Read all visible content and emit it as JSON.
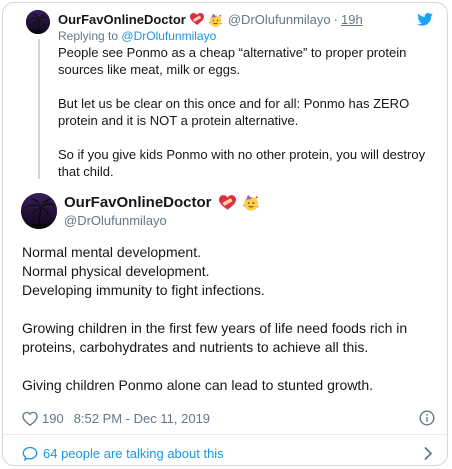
{
  "parent_tweet": {
    "display_name": "OurFavOnlineDoctor",
    "name_emojis": [
      "heart-bandage-icon",
      "party-face-icon"
    ],
    "handle": "@DrOlufunmilayo",
    "separator": "·",
    "time": "19h",
    "replying_prefix": "Replying to",
    "replying_handle": "@DrOlufunmilayo",
    "paragraphs": [
      "People see Ponmo as a cheap “alternative” to proper protein sources like meat, milk or eggs.",
      "But let us be clear on this once and for all: Ponmo has ZERO protein and it is NOT a protein alternative.",
      "So if you give kids Ponmo with no other protein, you will destroy that child."
    ]
  },
  "main_tweet": {
    "display_name": "OurFavOnlineDoctor",
    "handle": "@DrOlufunmilayo",
    "paragraphs": [
      "Normal mental development.\nNormal physical development.\nDeveloping immunity to fight infections.",
      "Growing children in the first few years of life need foods rich in proteins, carbohydrates and nutrients to achieve all this.",
      "Giving children Ponmo alone can lead to stunted growth."
    ],
    "likes": "190",
    "timestamp": "8:52 PM - Dec 11, 2019"
  },
  "footer": {
    "conversation_text": "64 people are talking about this"
  },
  "colors": {
    "text": "#14171a",
    "muted": "#657786",
    "link": "#1b95e0",
    "twitter_blue": "#1da1f2",
    "border": "#cfd9de"
  }
}
